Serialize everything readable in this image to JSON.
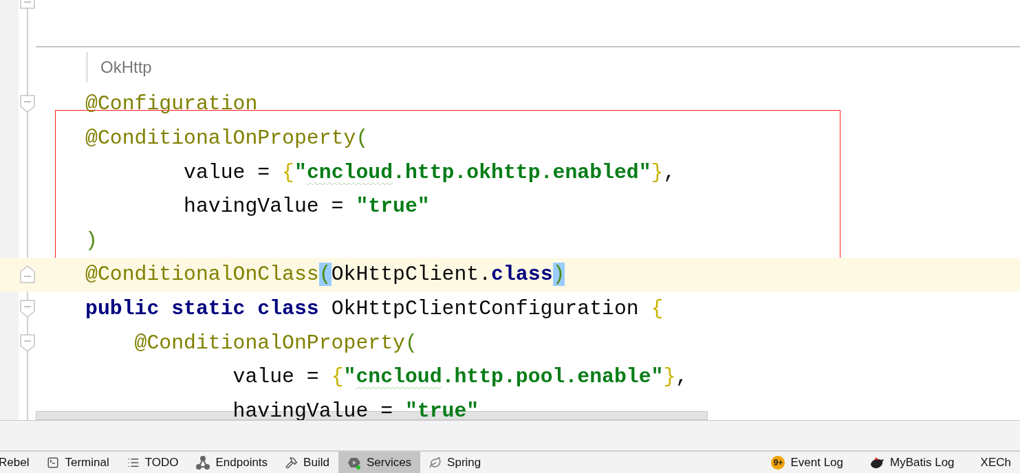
{
  "editor": {
    "lines": [
      {
        "kind": "fold_end",
        "current": false
      },
      {
        "kind": "separator"
      },
      {
        "kind": "doc",
        "text": "OkHttp"
      },
      {
        "kind": "fold_start",
        "current": false,
        "tokens": [
          {
            "kind": "annotation",
            "text": "@Configuration"
          }
        ]
      },
      {
        "kind": "code",
        "current": false,
        "tokens": [
          {
            "kind": "annotation",
            "text": "@ConditionalOnProperty"
          },
          {
            "kind": "paren",
            "text": "("
          }
        ]
      },
      {
        "kind": "code",
        "current": false,
        "tokens": [
          {
            "kind": "plain",
            "text": "        value = "
          },
          {
            "kind": "brace",
            "text": "{"
          },
          {
            "kind": "string",
            "text": "\""
          },
          {
            "kind": "string",
            "text": "cncloud",
            "typo": true
          },
          {
            "kind": "string",
            "text": ".http.okhttp.enabled\""
          },
          {
            "kind": "brace",
            "text": "}"
          },
          {
            "kind": "plain",
            "text": ","
          }
        ]
      },
      {
        "kind": "code",
        "current": false,
        "tokens": [
          {
            "kind": "plain",
            "text": "        havingValue = "
          },
          {
            "kind": "string",
            "text": "\"true\""
          }
        ]
      },
      {
        "kind": "code",
        "current": false,
        "tokens": [
          {
            "kind": "paren",
            "text": ")"
          }
        ]
      },
      {
        "kind": "fold_end",
        "current": true,
        "tokens": [
          {
            "kind": "annotation",
            "text": "@ConditionalOnClass"
          },
          {
            "kind": "paren",
            "text": "(",
            "matched": true
          },
          {
            "kind": "plain",
            "text": "OkHttpClient."
          },
          {
            "kind": "keyword",
            "text": "class"
          },
          {
            "kind": "paren",
            "text": ")",
            "matched": true
          }
        ]
      },
      {
        "kind": "fold_start",
        "current": false,
        "tokens": [
          {
            "kind": "keyword",
            "text": "public static class"
          },
          {
            "kind": "plain",
            "text": " OkHttpClientConfiguration "
          },
          {
            "kind": "brace",
            "text": "{"
          }
        ]
      },
      {
        "kind": "fold_start",
        "current": false,
        "tokens": [
          {
            "kind": "annotation",
            "text": "    @ConditionalOnProperty"
          },
          {
            "kind": "paren",
            "text": "("
          }
        ]
      },
      {
        "kind": "code",
        "current": false,
        "tokens": [
          {
            "kind": "plain",
            "text": "            value = "
          },
          {
            "kind": "brace",
            "text": "{"
          },
          {
            "kind": "string",
            "text": "\""
          },
          {
            "kind": "string",
            "text": "cncloud",
            "typo": true
          },
          {
            "kind": "string",
            "text": ".http.pool.enable\""
          },
          {
            "kind": "brace",
            "text": "}"
          },
          {
            "kind": "plain",
            "text": ","
          }
        ]
      },
      {
        "kind": "code",
        "current": false,
        "tokens": [
          {
            "kind": "plain",
            "text": "            havingValue = "
          },
          {
            "kind": "string",
            "text": "\"true\""
          }
        ]
      }
    ]
  },
  "tool_bar": {
    "left": [
      {
        "label": "Rebel",
        "selected": false
      },
      {
        "label": "Terminal",
        "selected": false
      },
      {
        "label": "TODO",
        "selected": false
      },
      {
        "label": "Endpoints",
        "selected": false
      },
      {
        "label": "Build",
        "selected": false
      },
      {
        "label": "Services",
        "selected": true
      },
      {
        "label": "Spring",
        "selected": false
      }
    ],
    "right": [
      {
        "badge": "9+",
        "label": "Event Log",
        "selected": false
      },
      {
        "label": "MyBatis Log",
        "selected": false
      },
      {
        "label": "XECh",
        "selected": false
      }
    ]
  }
}
